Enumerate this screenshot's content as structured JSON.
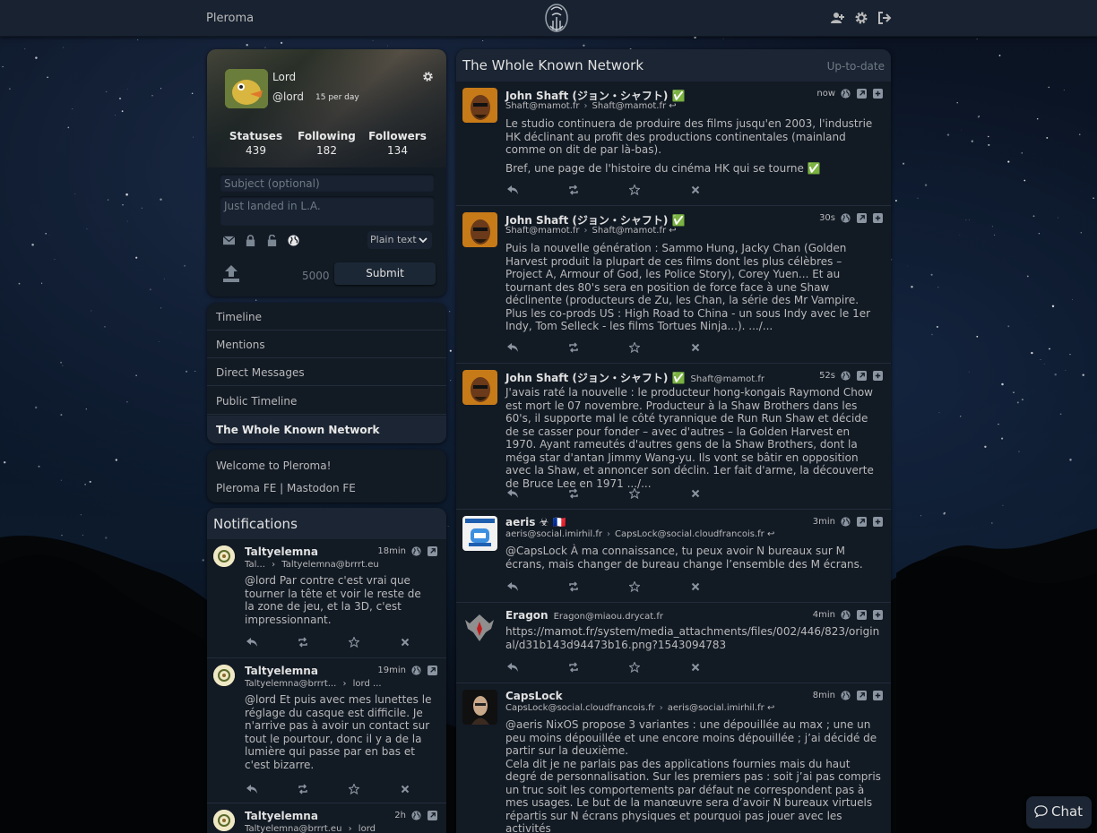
{
  "header": {
    "site_name": "Pleroma",
    "icons": [
      "user-plus-icon",
      "gear-icon",
      "logout-icon"
    ]
  },
  "user_card": {
    "display_name": "Lord",
    "handle": "@lord",
    "post_rate": "15 per day",
    "stats": [
      {
        "label": "Statuses",
        "value": "439"
      },
      {
        "label": "Following",
        "value": "182"
      },
      {
        "label": "Followers",
        "value": "134"
      }
    ]
  },
  "post_form": {
    "subject_placeholder": "Subject (optional)",
    "status_placeholder": "Just landed in L.A.",
    "format": "Plain text",
    "char_count": "5000",
    "submit_label": "Submit",
    "scope_icons": [
      "envelope-icon",
      "lock-icon",
      "unlock-icon",
      "globe-icon"
    ]
  },
  "nav": {
    "items": [
      "Timeline",
      "Mentions",
      "Direct Messages",
      "Public Timeline",
      "The Whole Known Network"
    ],
    "active_index": 4
  },
  "welcome": {
    "text": "Welcome to Pleroma!",
    "links": "Pleroma FE | Mastodon FE"
  },
  "notifications": {
    "title": "Notifications",
    "items": [
      {
        "name": "Taltyelemna",
        "time": "18min",
        "sub_from": "Tal...",
        "sub_to": "Taltyelemna@brrrt.eu",
        "text": "@lord Par contre c'est vrai que tourner la tête et voir le reste de la zone de jeu, et la 3D, c'est impressionnant."
      },
      {
        "name": "Taltyelemna",
        "time": "19min",
        "sub_from": "Taltyelemna@brrrt...",
        "sub_to": "lord ...",
        "text": "@lord Et puis avec mes lunettes le réglage du casque est difficile. Je n'arrive pas à avoir un contact sur tout le pourtour, donc il y a de la lumière qui passe par en bas et c'est bizarre."
      },
      {
        "name": "Taltyelemna",
        "time": "2h",
        "sub_from": "Taltyelemna@brrrt.eu",
        "sub_to": "lord",
        "text": ""
      }
    ]
  },
  "timeline": {
    "title": "The Whole Known Network",
    "status": "Up-to-date",
    "posts": [
      {
        "name": "John Shaft (ジョン・シャフト) ✅",
        "inline_handle": "",
        "time": "now",
        "sub_from": "Shaft@mamot.fr",
        "sub_to": "Shaft@mamot.fr",
        "paragraphs": [
          "Le studio continuera de produire des films jusqu'en 2003, l'industrie HK déclinant au profit des productions continentales (mainland comme on dit de par là-bas).",
          "Bref, une page de l'histoire du cinéma HK qui se tourne ✅"
        ]
      },
      {
        "name": "John Shaft (ジョン・シャフト) ✅",
        "inline_handle": "",
        "time": "30s",
        "sub_from": "Shaft@mamot.fr",
        "sub_to": "Shaft@mamot.fr",
        "paragraphs": [
          "Puis la nouvelle génération : Sammo Hung, Jacky Chan (Golden Harvest produit la plupart de ces films dont les plus célèbres – Project A, Armour of God, les Police Story), Corey Yuen... Et au tournant des 80's sera en position de force face à une Shaw déclinente (producteurs de Zu, les Chan, la série des Mr Vampire. Plus les co-prods US : High Road to China - un sous Indy avec le 1er Indy, Tom Selleck - les films Tortues Ninja...). .../..."
        ]
      },
      {
        "name": "John Shaft (ジョン・シャフト) ✅",
        "inline_handle": "Shaft@mamot.fr",
        "time": "52s",
        "sub_from": "",
        "sub_to": "",
        "paragraphs": [
          "J'avais raté la nouvelle : le producteur hong-kongais Raymond Chow est mort le 07 novembre. Producteur à la Shaw Brothers dans les 60's, il supporte mal le côté tyrannique de Run Run Shaw et décide de se casser pour fonder – avec d'autres – la Golden Harvest en 1970. Ayant rameutés d'autres gens de la Shaw Brothers, dont la méga star d'antan Jimmy Wang-yu. Ils vont se bâtir en opposition avec la Shaw, et annoncer son déclin. 1er fait d'arme, la découverte de Bruce Lee en 1971 .../..."
        ]
      },
      {
        "name": "aeris ☣ 🇫🇷",
        "inline_handle": "",
        "time": "3min",
        "sub_from": "aeris@social.imirhil.fr",
        "sub_to": "CapsLock@social.cloudfrancois.fr",
        "paragraphs": [
          "@CapsLock À ma connaissance, tu peux avoir N bureaux sur M écrans, mais changer de bureau change l’ensemble des M écrans."
        ]
      },
      {
        "name": "Eragon",
        "inline_handle": "Eragon@miaou.drycat.fr",
        "time": "4min",
        "sub_from": "",
        "sub_to": "",
        "paragraphs": [
          "https://mamot.fr/system/media_attachments/files/002/446/823/original/d31b143d94473b16.png?1543094783"
        ]
      },
      {
        "name": "CapsLock",
        "inline_handle": "",
        "time": "8min",
        "sub_from": "CapsLock@social.cloudfrancois.fr",
        "sub_to": "aeris@social.imirhil.fr",
        "paragraphs": [
          "@aeris NixOS propose 3 variantes : une dépouillée au max ; une un peu moins dépouillée et une encore moins dépouillée ; j’ai décidé de partir sur la deuxième.",
          "Cela dit je ne parlais pas des applications fournies mais du haut degré de personnalisation. Sur les premiers pas : soit j’ai pas compris un truc soit les comportements par défaut ne correspondent pas à mes usages. Le but de la manœuvre sera d’avoir N bureaux virtuels répartis sur N écrans physiques et pourquoi pas jouer avec les activités"
        ]
      }
    ]
  },
  "chat": {
    "label": "Chat"
  },
  "colors": {
    "background": "#121a24",
    "foreground": "#182230",
    "text": "#b9b9ba",
    "link": "#d8a070"
  }
}
